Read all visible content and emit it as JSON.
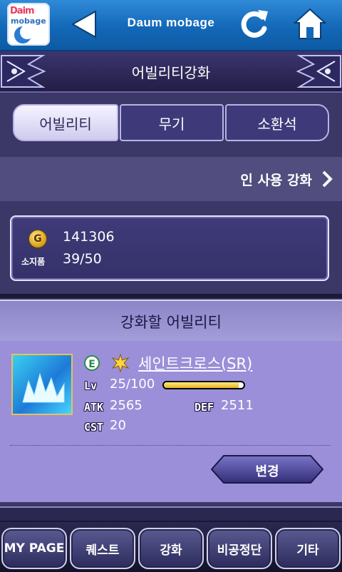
{
  "topbar": {
    "logo_line1": "Daim",
    "logo_line2": "mobage",
    "brand": "Daum mobage"
  },
  "header": {
    "title": "어빌리티강화"
  },
  "tabs": [
    {
      "label": "어빌리티",
      "active": true
    },
    {
      "label": "무기",
      "active": false
    },
    {
      "label": "소환석",
      "active": false
    }
  ],
  "link": {
    "label": "인 사용 강화"
  },
  "stats": {
    "gold_icon_letter": "G",
    "gold": "141306",
    "owned_label": "소지품",
    "owned": "39/50"
  },
  "panel": {
    "title": "강화할 어빌리티"
  },
  "card": {
    "element_letter": "E",
    "name": "세인트크로스(SR)",
    "lv_label": "Lv",
    "level": "25/100",
    "level_progress": 0.94,
    "atk_label": "ATK",
    "atk": "2565",
    "def_label": "DEF",
    "def": "2511",
    "cst_label": "CST",
    "cst": "20",
    "change_label": "변경"
  },
  "nav": [
    {
      "label": "MY PAGE"
    },
    {
      "label": "퀘스트"
    },
    {
      "label": "강화"
    },
    {
      "label": "비공정단"
    },
    {
      "label": "기타"
    }
  ],
  "colors": {
    "accent": "#1368b8",
    "panel": "#9a8fd8",
    "background": "#3b3766"
  }
}
